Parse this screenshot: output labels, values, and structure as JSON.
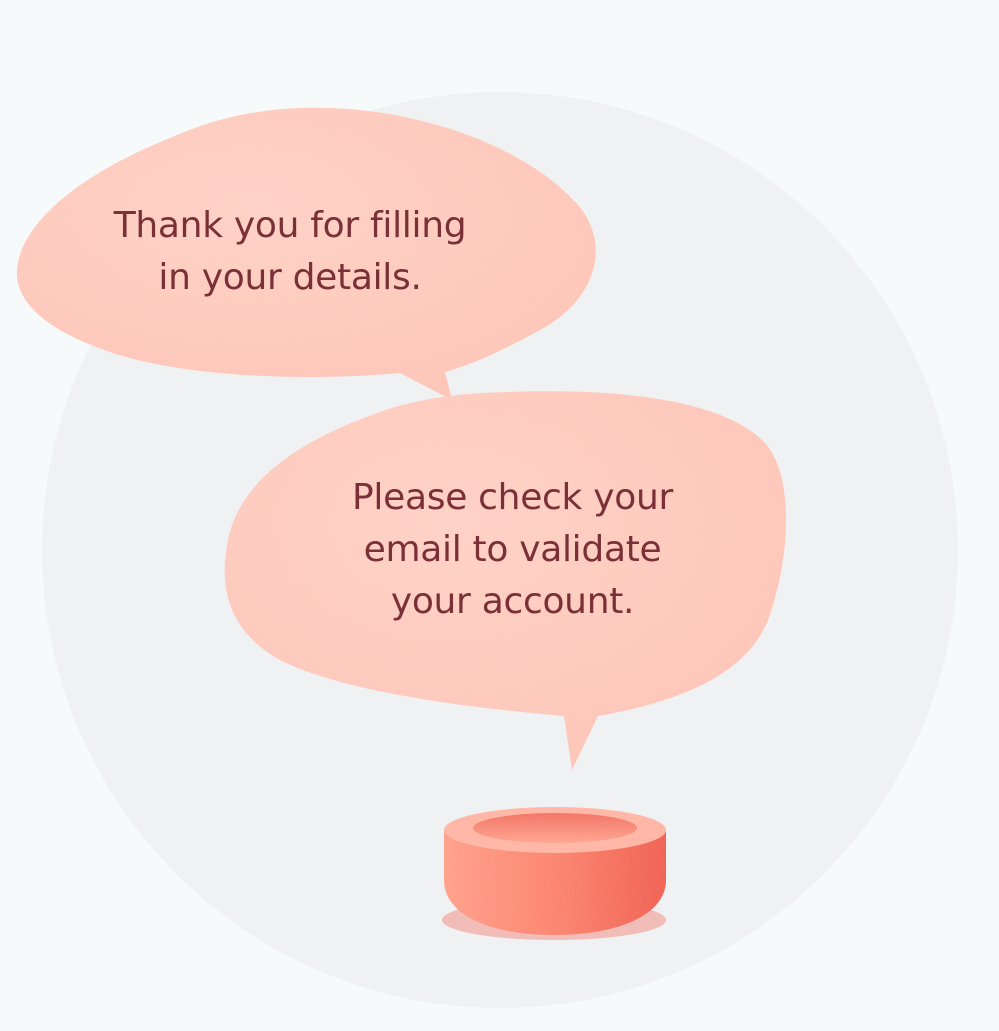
{
  "messages": {
    "first": {
      "line1": "Thank you for filling",
      "line2": "in your details."
    },
    "second": {
      "line1": "Please check your",
      "line2": "email to validate",
      "line3": "your account."
    }
  },
  "colors": {
    "page_background": "#f7fafb",
    "circle_background": "#f0f1f2",
    "bubble_fill": "#ffcbbe",
    "text": "#7a3036",
    "speaker_base": "#fd7b62"
  },
  "icons": {
    "speaker": "speaker-base-icon"
  }
}
